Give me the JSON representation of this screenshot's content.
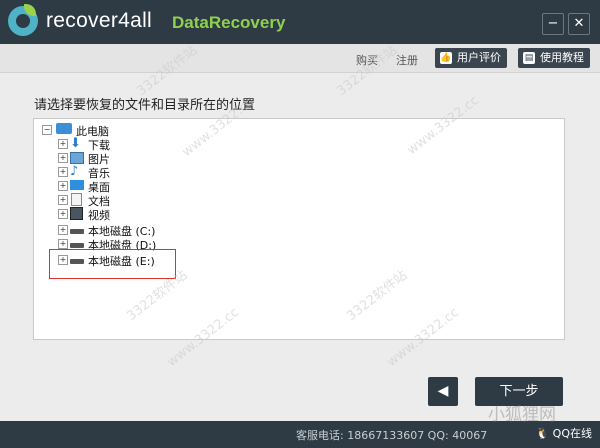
{
  "titlebar": {
    "app_name": "recover4all",
    "product": "DataRecovery",
    "minimize": "−",
    "close": "✕"
  },
  "toolbar": {
    "buy": "购买",
    "register": "注册",
    "review": "用户评价",
    "tutorial": "使用教程"
  },
  "heading": "请选择要恢复的文件和目录所在的位置",
  "tree": {
    "root": "此电脑",
    "items": [
      {
        "label": "下载",
        "icon": "download-icon"
      },
      {
        "label": "图片",
        "icon": "pictures-icon"
      },
      {
        "label": "音乐",
        "icon": "music-icon"
      },
      {
        "label": "桌面",
        "icon": "desktop-icon"
      },
      {
        "label": "文档",
        "icon": "document-icon"
      },
      {
        "label": "视频",
        "icon": "video-icon"
      },
      {
        "label": "本地磁盘 (C:)",
        "icon": "drive-icon"
      },
      {
        "label": "本地磁盘 (D:)",
        "icon": "drive-icon"
      },
      {
        "label": "本地磁盘 (E:)",
        "icon": "drive-icon"
      }
    ]
  },
  "nav": {
    "back": "◀",
    "next": "下一步"
  },
  "status": {
    "service": "客服电话: 18667133607 QQ: 40067",
    "qq": "QQ在线"
  },
  "watermarks": [
    "3322软件站",
    "www.3322.cc",
    "小狐狸网"
  ],
  "colors": {
    "dark": "#2e3a44",
    "accent_green": "#8fd14f",
    "selection": "#e0302a"
  }
}
